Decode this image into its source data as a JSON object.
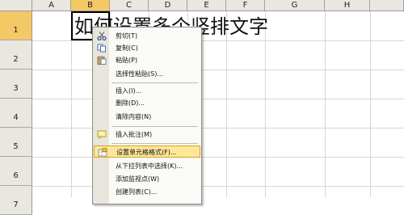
{
  "sheet": {
    "columns": [
      "A",
      "B",
      "C",
      "D",
      "E",
      "F",
      "G",
      "H"
    ],
    "rows": [
      "1",
      "2",
      "3",
      "4",
      "5",
      "6",
      "7"
    ],
    "cell_b1": "如何设置多个竖排文字",
    "selected_column": "B",
    "selected_row": "1"
  },
  "context_menu": {
    "items": [
      {
        "label": "剪切(T)",
        "icon": "scissors-icon"
      },
      {
        "label": "复制(C)",
        "icon": "copy-icon"
      },
      {
        "label": "粘贴(P)",
        "icon": "paste-icon"
      },
      {
        "label": "选择性粘贴(S)...",
        "icon": ""
      },
      {
        "label": "插入(I)...",
        "icon": ""
      },
      {
        "label": "删除(D)...",
        "icon": ""
      },
      {
        "label": "清除内容(N)",
        "icon": ""
      },
      {
        "label": "插入批注(M)",
        "icon": "comment-icon"
      },
      {
        "label": "设置单元格格式(F)...",
        "icon": "format-cells-icon"
      },
      {
        "label": "从下拉列表中选择(K)...",
        "icon": ""
      },
      {
        "label": "添加监视点(W)",
        "icon": ""
      },
      {
        "label": "创建列表(C)...",
        "icon": ""
      }
    ],
    "highlighted": "设置单元格格式(F)...",
    "highlight_color": "#ffe79a"
  }
}
